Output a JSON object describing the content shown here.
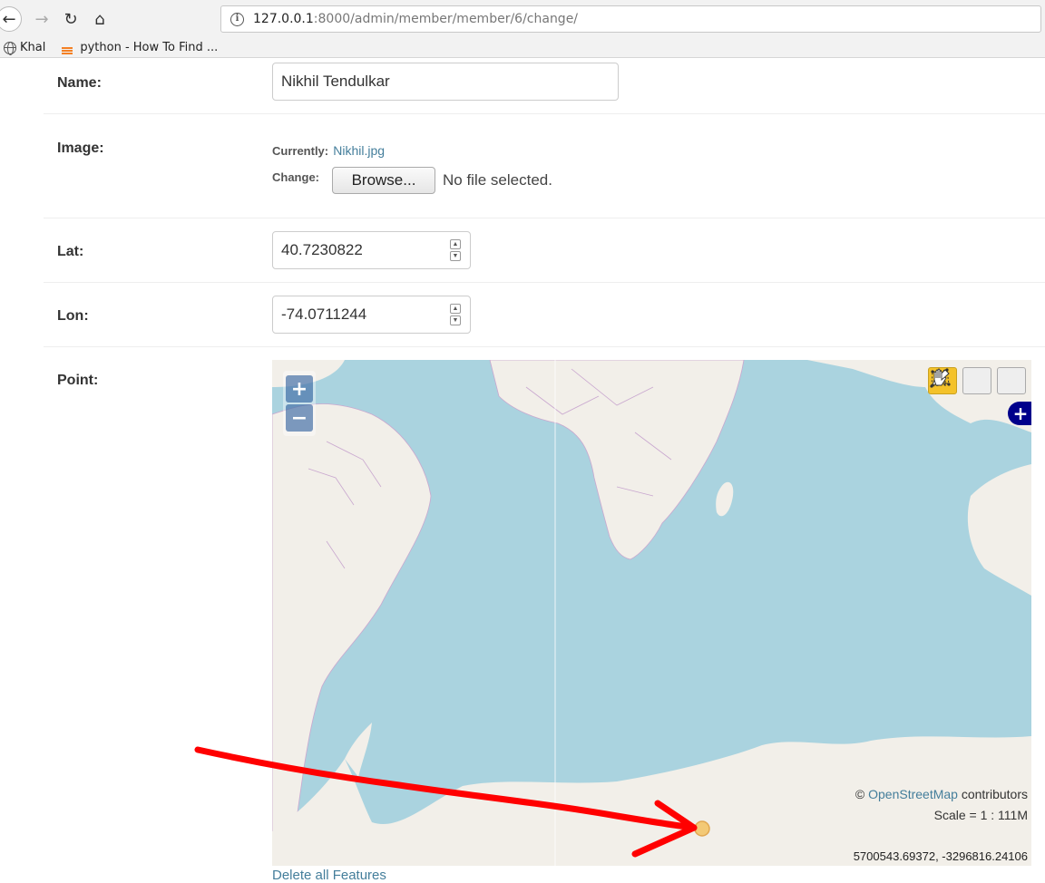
{
  "browser": {
    "url_host": "127.0.0.1",
    "url_path": ":8000/admin/member/member/6/change/",
    "bookmarks": [
      {
        "label": "Khal",
        "icon": "globe-icon"
      },
      {
        "label": "python - How To Find ...",
        "icon": "stackoverflow-icon"
      }
    ]
  },
  "form": {
    "name": {
      "label": "Name:",
      "value": "Nikhil Tendulkar"
    },
    "image": {
      "label": "Image:",
      "currently_label": "Currently:",
      "current_file": "Nikhil.jpg",
      "change_label": "Change:",
      "browse_label": "Browse...",
      "no_file_text": "No file selected."
    },
    "lat": {
      "label": "Lat:",
      "value": "40.7230822"
    },
    "lon": {
      "label": "Lon:",
      "value": "-74.0711244"
    },
    "point": {
      "label": "Point:"
    }
  },
  "map": {
    "zoom_in": "+",
    "zoom_out": "−",
    "layer_switcher": "+",
    "attribution_prefix": "©",
    "attribution_link": "OpenStreetMap",
    "attribution_suffix": " contributors",
    "scale_text": "Scale = 1 : 111M",
    "mouse_coords": "5700543.69372, -3296816.24106",
    "colors": {
      "water": "#aad3df",
      "land": "#f2efe9",
      "border": "#c9a7cf",
      "feature": "#f4c56a",
      "annotation": "#ff0000"
    }
  },
  "delete_all_link": "Delete all Features"
}
